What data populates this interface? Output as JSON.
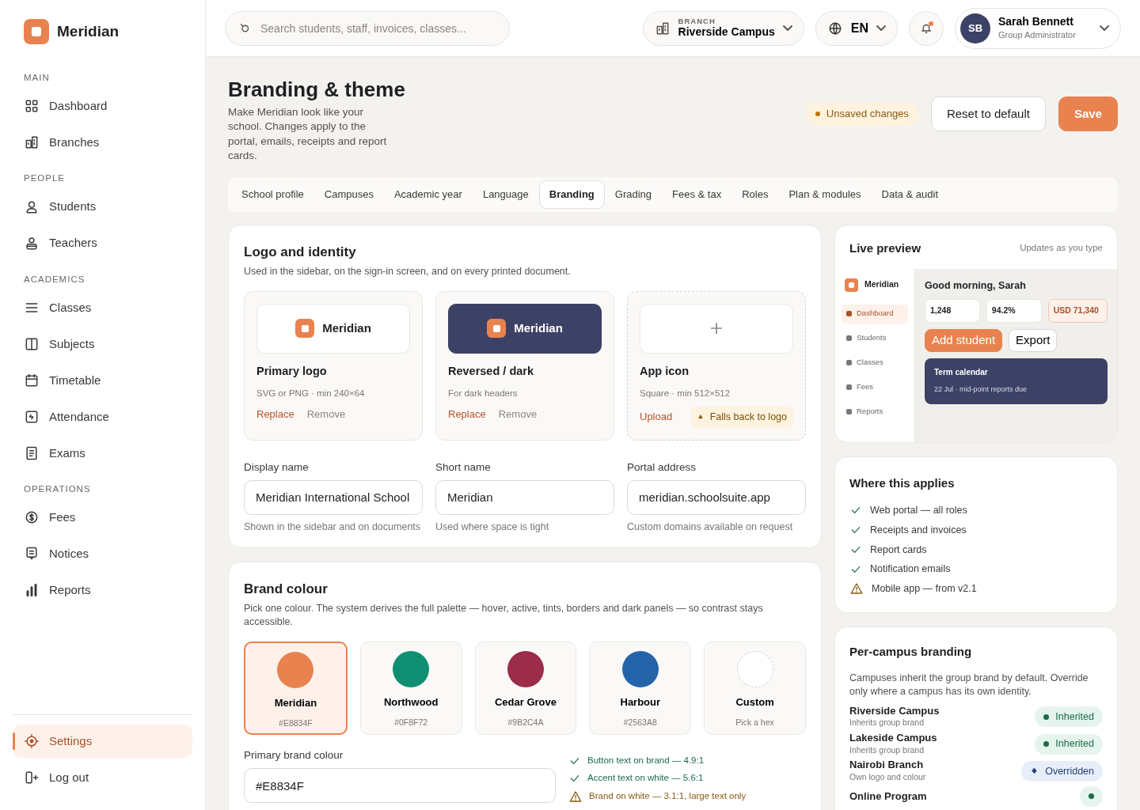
{
  "sidebar": {
    "brand": "Meridian",
    "sections": [
      {
        "title": "MAIN",
        "items": [
          {
            "label": "Dashboard",
            "selected": false
          },
          {
            "label": "Branches",
            "selected": false
          }
        ]
      },
      {
        "title": "PEOPLE",
        "items": [
          {
            "label": "Students",
            "selected": false
          },
          {
            "label": "Teachers",
            "selected": false
          }
        ]
      },
      {
        "title": "ACADEMICS",
        "items": [
          {
            "label": "Classes",
            "selected": false
          },
          {
            "label": "Subjects",
            "selected": false
          },
          {
            "label": "Timetable",
            "selected": false
          },
          {
            "label": "Attendance",
            "selected": false
          },
          {
            "label": "Exams",
            "selected": false
          }
        ]
      },
      {
        "title": "OPERATIONS",
        "items": [
          {
            "label": "Fees",
            "selected": false
          },
          {
            "label": "Notices",
            "selected": false
          },
          {
            "label": "Reports",
            "selected": false
          }
        ]
      }
    ],
    "footer": [
      {
        "label": "Settings",
        "selected": true
      },
      {
        "label": "Log out",
        "selected": false
      }
    ]
  },
  "topbar": {
    "search": {
      "placeholder": "Search students, staff, invoices, classes..."
    },
    "branch": {
      "label": "BRANCH",
      "value": "Riverside Campus"
    },
    "language": "EN",
    "notifications": {
      "unread": true
    },
    "user": {
      "initials": "SB",
      "name": "Sarah Bennett",
      "role": "Group Administrator"
    }
  },
  "header": {
    "title": "Branding & theme",
    "description": "Make Meridian look like your school. Changes apply to the portal, emails, receipts and report cards.",
    "status": "Unsaved changes",
    "buttons": [
      {
        "label": "Reset to default",
        "kind": "secondary"
      },
      {
        "label": "Save",
        "kind": "primary"
      }
    ]
  },
  "tabs": [
    {
      "label": "School profile",
      "selected": false
    },
    {
      "label": "Campuses",
      "selected": false
    },
    {
      "label": "Academic year",
      "selected": false
    },
    {
      "label": "Language",
      "selected": false
    },
    {
      "label": "Branding",
      "selected": true
    },
    {
      "label": "Grading",
      "selected": false
    },
    {
      "label": "Fees & tax",
      "selected": false
    },
    {
      "label": "Roles",
      "selected": false
    },
    {
      "label": "Plan & modules",
      "selected": false
    },
    {
      "label": "Data & audit",
      "selected": false
    }
  ],
  "logo_card": {
    "title": "Logo and identity",
    "subtitle": "Used in the sidebar, on the sign-in screen, and on every printed document.",
    "assets": [
      {
        "kind": "light",
        "brand": "Meridian",
        "title": "Primary logo",
        "note": "SVG or PNG · min 240×64",
        "actions": [
          {
            "label": "Replace",
            "kind": "primary"
          },
          {
            "label": "Remove",
            "kind": "secondary"
          }
        ]
      },
      {
        "kind": "dark",
        "brand": "Meridian",
        "title": "Reversed / dark",
        "note": "For dark headers",
        "actions": [
          {
            "label": "Replace",
            "kind": "primary"
          },
          {
            "label": "Remove",
            "kind": "secondary"
          }
        ]
      },
      {
        "kind": "empty",
        "title": "App icon",
        "note": "Square · min 512×512",
        "actions": [
          {
            "label": "Upload",
            "kind": "primary"
          }
        ],
        "warning": "Falls back to logo"
      }
    ],
    "fields": [
      {
        "label": "Display name",
        "value": "Meridian International School",
        "hint": "Shown in the sidebar and on documents"
      },
      {
        "label": "Short name",
        "value": "Meridian",
        "hint": "Used where space is tight"
      },
      {
        "label": "Portal address",
        "value": "meridian.schoolsuite.app",
        "hint": "Custom domains available on request"
      }
    ]
  },
  "brand_colour": {
    "title": "Brand colour",
    "description": "Pick one colour. The system derives the full palette — hover, active, tints, borders and dark panels — so contrast stays accessible.",
    "swatches": [
      {
        "kind": "preset",
        "name": "Meridian",
        "hex": "#E8834F",
        "color": "#e8834f",
        "selected": true
      },
      {
        "kind": "preset",
        "name": "Northwood",
        "hex": "#0F8F72",
        "color": "#0f8f72",
        "selected": false
      },
      {
        "kind": "preset",
        "name": "Cedar Grove",
        "hex": "#9B2C4A",
        "color": "#9b2c4a",
        "selected": false
      },
      {
        "kind": "preset",
        "name": "Harbour",
        "hex": "#2563A8",
        "color": "#2563a8",
        "selected": false
      },
      {
        "kind": "custom",
        "name": "Custom",
        "hex": "Pick a hex",
        "selected": false
      }
    ],
    "field": {
      "label": "Primary brand colour",
      "value": "#E8834F"
    },
    "checks": [
      {
        "kind": "pass",
        "text": "Button text on brand — 4.9:1"
      },
      {
        "kind": "pass",
        "text": "Accent text on white — 5.6:1"
      },
      {
        "kind": "warn",
        "text": "Brand on white — 3.1:1, large text only"
      }
    ]
  },
  "preview": {
    "title": "Live preview",
    "note": "Updates as you type",
    "brand": "Meridian",
    "nav": [
      {
        "label": "Dashboard",
        "selected": true
      },
      {
        "label": "Students",
        "selected": false
      },
      {
        "label": "Classes",
        "selected": false
      },
      {
        "label": "Fees",
        "selected": false
      },
      {
        "label": "Reports",
        "selected": false
      }
    ],
    "greeting": "Good morning, Sarah",
    "stats": [
      {
        "value": "1,248",
        "kind": "plain"
      },
      {
        "value": "94.2%",
        "kind": "plain"
      },
      {
        "value": "USD 71,340",
        "kind": "accent"
      }
    ],
    "buttons": [
      {
        "label": "Add student",
        "kind": "primary"
      },
      {
        "label": "Export",
        "kind": "secondary"
      }
    ],
    "calendar": {
      "title": "Term calendar",
      "text": "22 Jul · mid-point reports due"
    }
  },
  "applies": {
    "title": "Where this applies",
    "items": [
      {
        "kind": "ok",
        "text": "Web portal — all roles"
      },
      {
        "kind": "ok",
        "text": "Receipts and invoices"
      },
      {
        "kind": "ok",
        "text": "Report cards"
      },
      {
        "kind": "ok",
        "text": "Notification emails"
      },
      {
        "kind": "warn",
        "text": "Mobile app — from v2.1"
      }
    ]
  },
  "campuses": {
    "title": "Per-campus branding",
    "description": "Campuses inherit the group brand by default. Override only where a campus has its own identity.",
    "rows": [
      {
        "name": "Riverside Campus",
        "note": "Inherits group brand",
        "kind": "inherited",
        "label": "Inherited"
      },
      {
        "name": "Lakeside Campus",
        "note": "Inherits group brand",
        "kind": "inherited",
        "label": "Inherited"
      },
      {
        "name": "Nairobi Branch",
        "note": "Own logo and colour",
        "kind": "overridden",
        "label": "Overridden"
      },
      {
        "name": "Online Program",
        "kind": "inherited"
      }
    ]
  }
}
